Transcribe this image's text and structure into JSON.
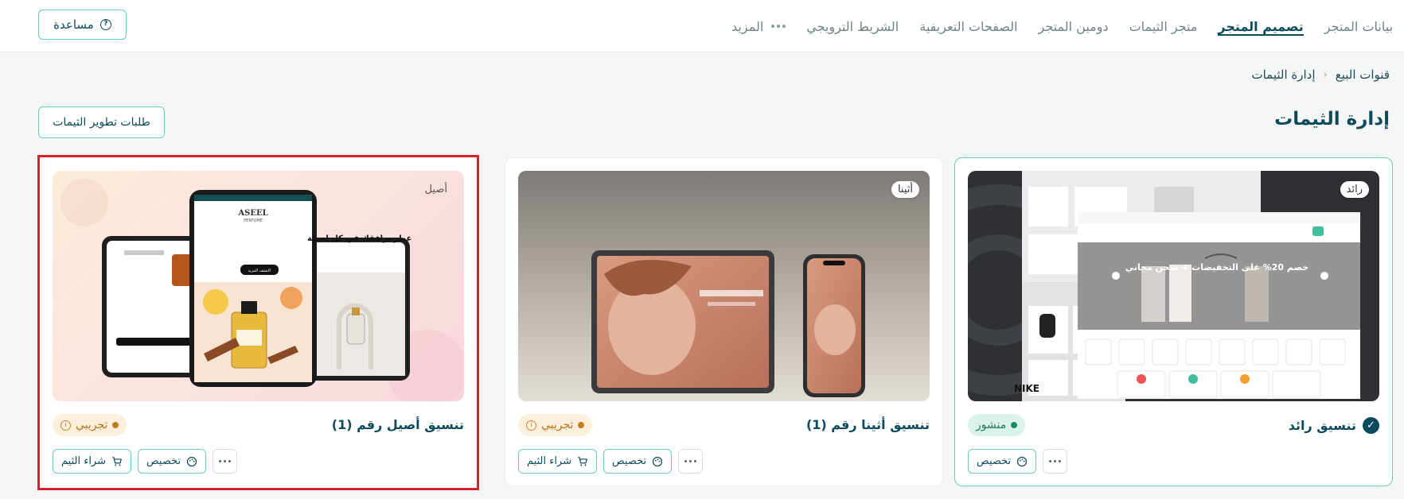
{
  "topbar": {
    "tabs": [
      {
        "label": "بيانات المتجر"
      },
      {
        "label": "تصميم المتجر"
      },
      {
        "label": "متجر الثيمات"
      },
      {
        "label": "دومين المتجر"
      },
      {
        "label": "الصفحات التعريفية"
      },
      {
        "label": "الشريط الترويجي"
      },
      {
        "label": "المزيد"
      }
    ],
    "active_tab": "تصميم المتجر",
    "help_label": "مساعدة"
  },
  "breadcrumb": {
    "items": [
      "قنوات البيع",
      "إدارة الثيمات"
    ]
  },
  "page": {
    "title": "إدارة الثيمات",
    "dev_requests_label": "طلبات تطوير الثيمات"
  },
  "themes": [
    {
      "name": "تنسيق رائد",
      "thumb_label": "رائد",
      "status": "منشور",
      "status_type": "published",
      "current": true,
      "actions": {
        "customize": "تخصيص"
      },
      "preview": {
        "banner": "خصم 20% على التخفيضات + شحن مجاني",
        "brand": "NIKE"
      }
    },
    {
      "name": "تنسيق أثينا رقم (1)",
      "thumb_label": "أثينا",
      "status": "تجريبي",
      "status_type": "trial",
      "actions": {
        "buy": "شراء الثيم",
        "customize": "تخصيص"
      }
    },
    {
      "name": "تنسيق أصيل رقم (1)",
      "thumb_label": "أصيل",
      "status": "تجريبي",
      "status_type": "trial",
      "selected": true,
      "actions": {
        "buy": "شراء الثيم",
        "customize": "تخصيص"
      },
      "preview": {
        "headline": "عطر يرافقك في كل لحظة",
        "brand": "ASEEL",
        "brand_sub": "PERFUME",
        "cta": "اكتشف المزيد"
      }
    }
  ],
  "colors": {
    "primary": "#0c4b5b",
    "accent_border": "#6ccbb5",
    "published": "#1a8a63",
    "trial": "#c07c23",
    "selected_outline": "#d81f2c"
  }
}
